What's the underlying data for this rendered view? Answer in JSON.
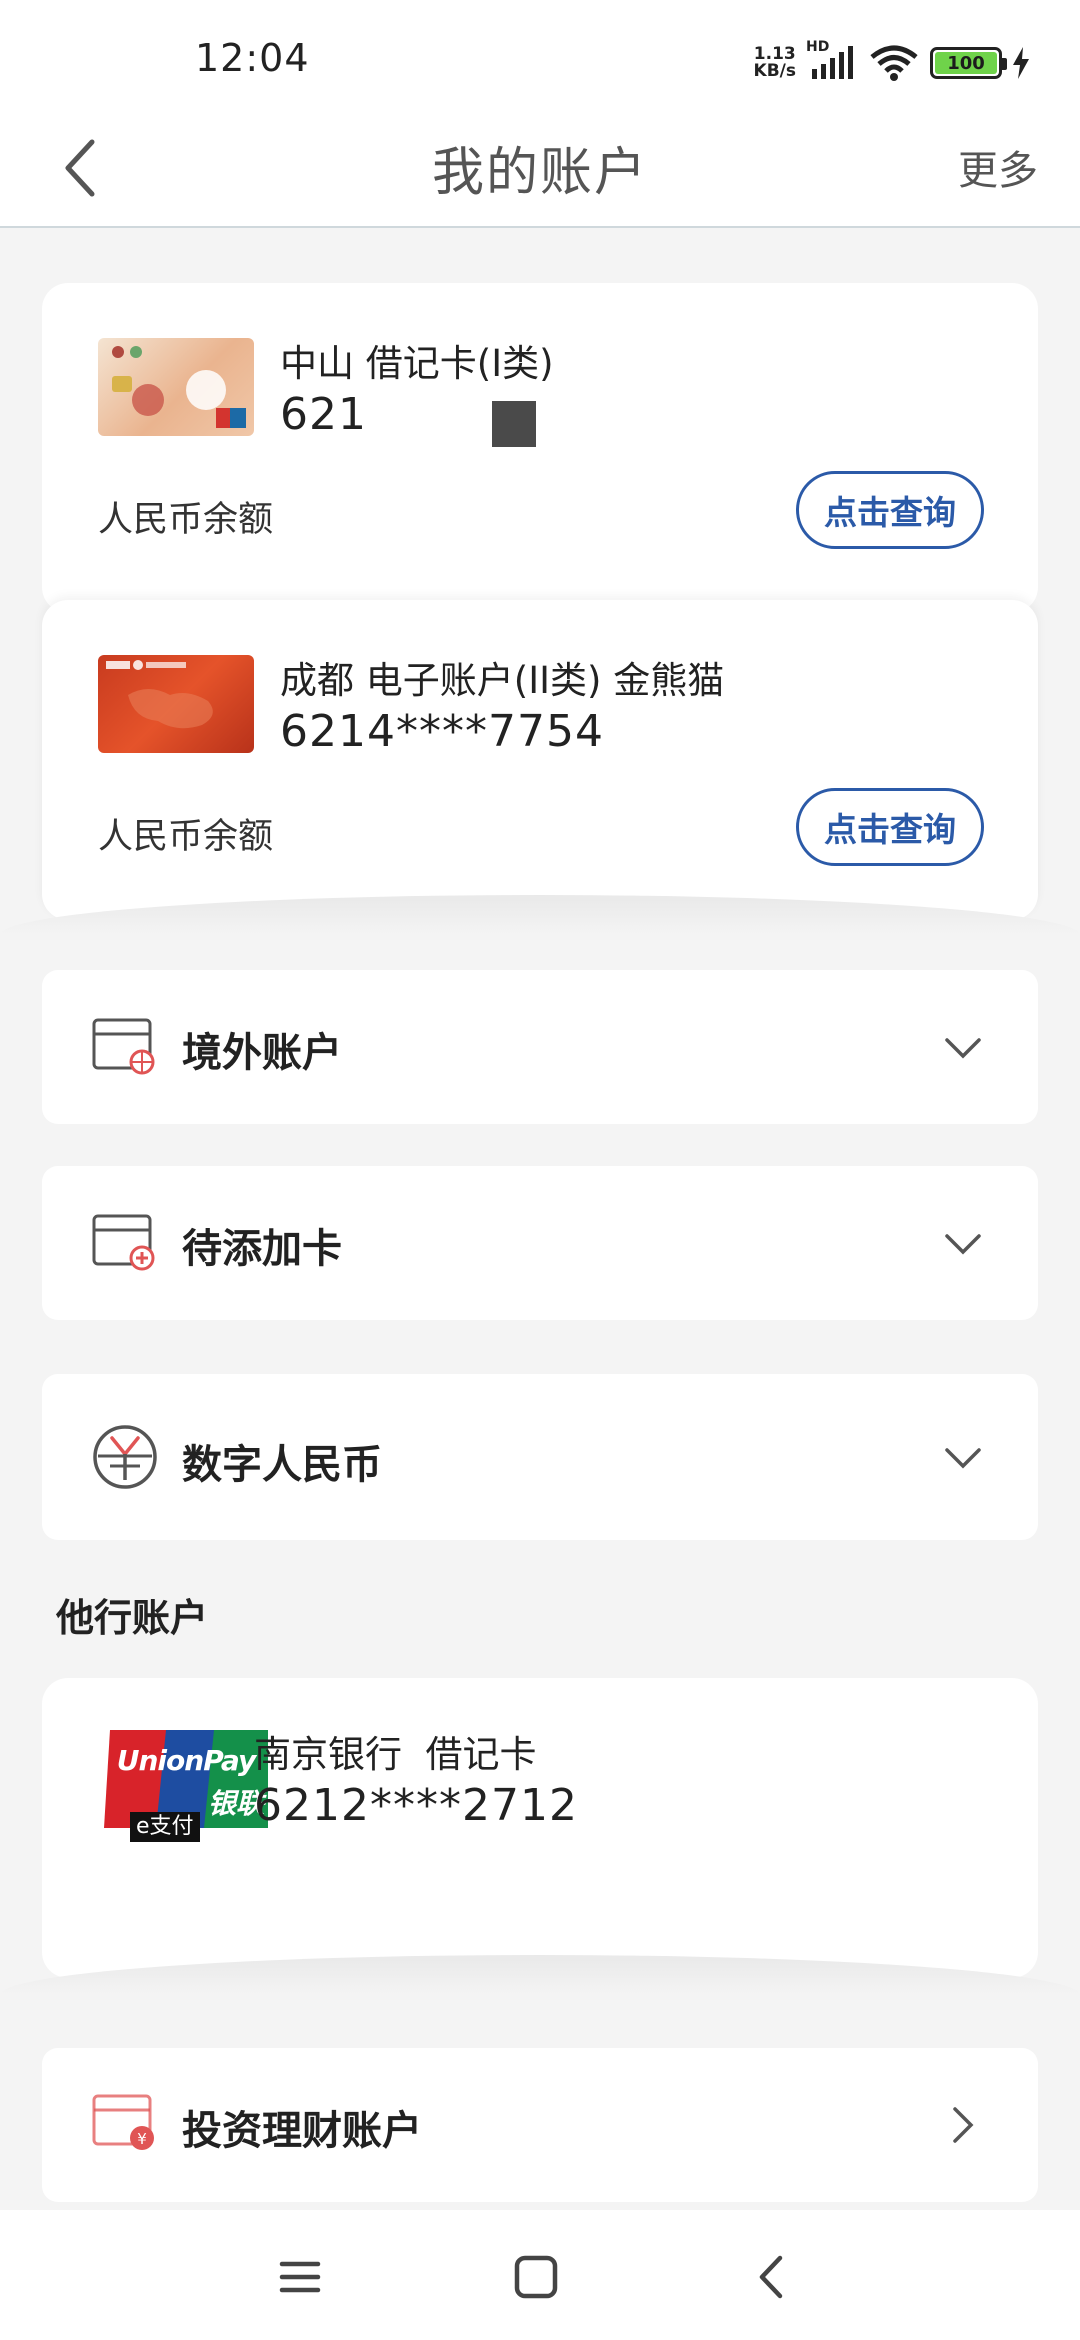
{
  "status": {
    "time": "12:04",
    "speed_value": "1.13",
    "speed_unit": "KB/s",
    "network": "HD",
    "battery": "100"
  },
  "header": {
    "title": "我的账户",
    "more": "更多"
  },
  "accounts": [
    {
      "name": "中山 借记卡(I类)",
      "number": "621",
      "balance_label": "人民币余额",
      "query_label": "点击查询"
    },
    {
      "name": "成都 电子账户(II类) 金熊猫",
      "number": "6214****7754",
      "balance_label": "人民币余额",
      "query_label": "点击查询"
    }
  ],
  "sections": [
    {
      "label": "境外账户",
      "icon": "overseas-card-icon"
    },
    {
      "label": "待添加卡",
      "icon": "add-card-icon"
    },
    {
      "label": "数字人民币",
      "icon": "digital-yuan-icon"
    }
  ],
  "other_accounts": {
    "title": "他行账户",
    "items": [
      {
        "bank": "南京银行  借记卡",
        "number": "6212****2712",
        "logo_text": "UnionPay",
        "logo_cn": "银联",
        "badge": "e支付"
      }
    ]
  },
  "investment": {
    "label": "投资理财账户",
    "icon": "investment-account-icon"
  },
  "colors": {
    "accent": "#2b5aa8",
    "icon_red": "#e05555",
    "background": "#f4f4f4"
  }
}
